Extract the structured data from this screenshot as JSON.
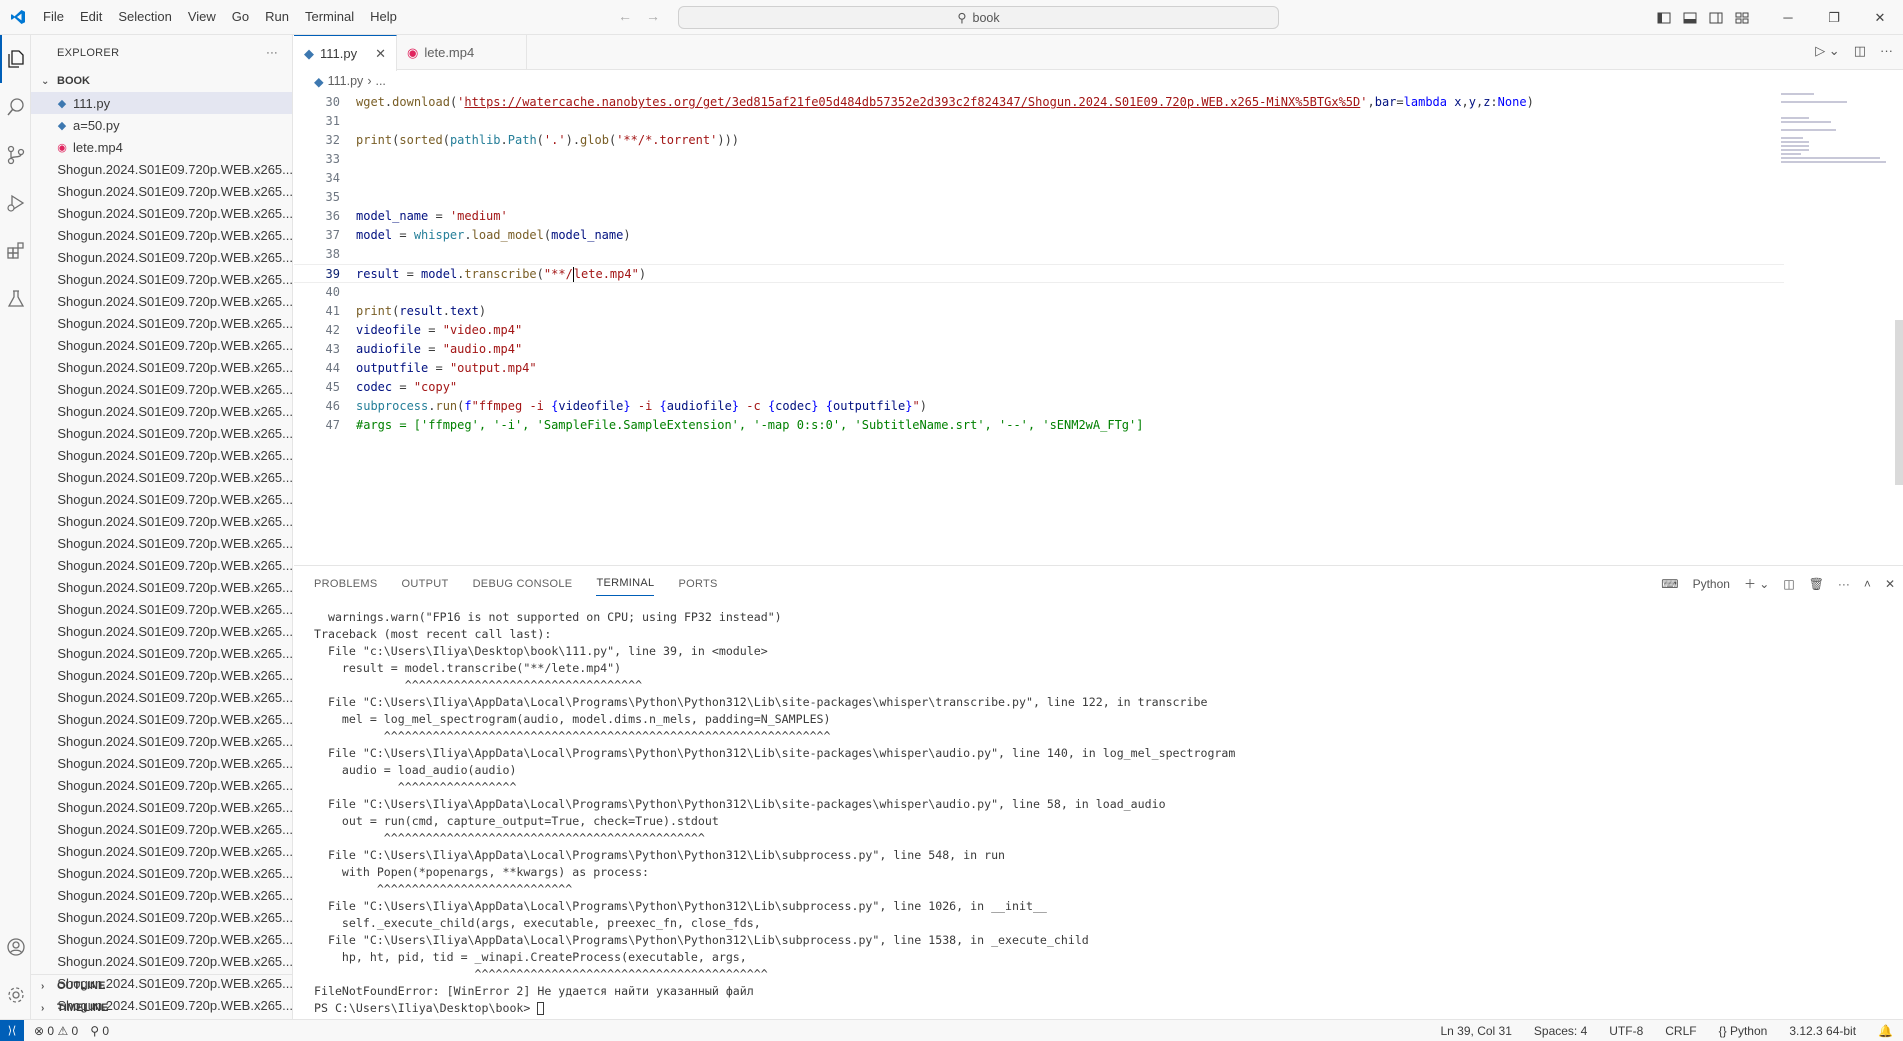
{
  "menu": [
    "File",
    "Edit",
    "Selection",
    "View",
    "Go",
    "Run",
    "Terminal",
    "Help"
  ],
  "search": {
    "text": "book"
  },
  "sidebar": {
    "title": "EXPLORER",
    "folder": "BOOK",
    "files": [
      {
        "name": "111.py",
        "type": "py",
        "active": true
      },
      {
        "name": "a=50.py",
        "type": "py"
      },
      {
        "name": "lete.mp4",
        "type": "mp4"
      }
    ],
    "repeat_file": "Shogun.2024.S01E09.720p.WEB.x265...",
    "repeat_count": 40,
    "outline": "OUTLINE",
    "timeline": "TIMELINE"
  },
  "tabs": [
    {
      "label": "111.py",
      "active": true
    },
    {
      "label": "lete.mp4",
      "active": false
    }
  ],
  "breadcrumb": {
    "file": "111.py",
    "more": "..."
  },
  "code": [
    {
      "n": "30",
      "html": "<span class=\"tk-fn\">wget</span>.<span class=\"tk-fn\">download</span>(<span class=\"tk-str\">'</span><span class=\"tk-url\">https://watercache.nanobytes.org/get/3ed815af21fe05d484db57352e2d393c2f824347/Shogun.2024.S01E09.720p.WEB.x265-MiNX%5BTGx%5D</span><span class=\"tk-str\">'</span>,<span class=\"tk-var\">bar</span>=<span class=\"tk-kw\">lambda</span> <span class=\"tk-var\">x</span>,<span class=\"tk-var\">y</span>,<span class=\"tk-var\">z</span>:<span class=\"tk-kw\">None</span>)"
    },
    {
      "n": "31",
      "html": ""
    },
    {
      "n": "32",
      "html": "<span class=\"tk-fn\">print</span>(<span class=\"tk-fn\">sorted</span>(<span class=\"tk-cls\">pathlib</span>.<span class=\"tk-cls\">Path</span>(<span class=\"tk-str\">'.'</span>).<span class=\"tk-fn\">glob</span>(<span class=\"tk-str\">'**/*.torrent'</span>)))"
    },
    {
      "n": "33",
      "html": ""
    },
    {
      "n": "34",
      "html": ""
    },
    {
      "n": "35",
      "html": ""
    },
    {
      "n": "36",
      "html": "<span class=\"tk-var\">model_name</span> = <span class=\"tk-str\">'medium'</span>"
    },
    {
      "n": "37",
      "html": "<span class=\"tk-var\">model</span> = <span class=\"tk-cls\">whisper</span>.<span class=\"tk-fn\">load_model</span>(<span class=\"tk-var\">model_name</span>)"
    },
    {
      "n": "38",
      "html": ""
    },
    {
      "n": "39",
      "html": "<span class=\"tk-var\">result</span> = <span class=\"tk-var\">model</span>.<span class=\"tk-fn\">transcribe</span>(<span class=\"tk-str\">\"**/</span><span class=\"cursor\"></span><span class=\"tk-str\">lete.mp4\"</span>)",
      "current": true
    },
    {
      "n": "40",
      "html": ""
    },
    {
      "n": "41",
      "html": "<span class=\"tk-fn\">print</span>(<span class=\"tk-var\">result</span>.<span class=\"tk-var\">text</span>)"
    },
    {
      "n": "42",
      "html": "<span class=\"tk-var\">videofile</span> = <span class=\"tk-str\">\"video.mp4\"</span>"
    },
    {
      "n": "43",
      "html": "<span class=\"tk-var\">audiofile</span> = <span class=\"tk-str\">\"audio.mp4\"</span>"
    },
    {
      "n": "44",
      "html": "<span class=\"tk-var\">outputfile</span> = <span class=\"tk-str\">\"output.mp4\"</span>"
    },
    {
      "n": "45",
      "html": "<span class=\"tk-var\">codec</span> = <span class=\"tk-str\">\"copy\"</span>"
    },
    {
      "n": "46",
      "html": "<span class=\"tk-cls\">subprocess</span>.<span class=\"tk-fn\">run</span>(<span class=\"tk-kw\">f</span><span class=\"tk-str\">\"ffmpeg -i </span><span class=\"tk-kw\">{</span><span class=\"tk-var\">videofile</span><span class=\"tk-kw\">}</span><span class=\"tk-str\"> -i </span><span class=\"tk-kw\">{</span><span class=\"tk-var\">audiofile</span><span class=\"tk-kw\">}</span><span class=\"tk-str\"> -c </span><span class=\"tk-kw\">{</span><span class=\"tk-var\">codec</span><span class=\"tk-kw\">}</span><span class=\"tk-str\"> </span><span class=\"tk-kw\">{</span><span class=\"tk-var\">outputfile</span><span class=\"tk-kw\">}</span><span class=\"tk-str\">\"</span>)"
    },
    {
      "n": "47",
      "html": "<span class=\"tk-cm\">#args = ['ffmpeg', '-i', 'SampleFile.SampleExtension', '-map 0:s:0', 'SubtitleName.srt', '--', 'sENM2wA_FTg']</span>"
    }
  ],
  "panel": {
    "tabs": [
      "PROBLEMS",
      "OUTPUT",
      "DEBUG CONSOLE",
      "TERMINAL",
      "PORTS"
    ],
    "active_tab": "TERMINAL",
    "shell": "Python"
  },
  "terminal": [
    "  warnings.warn(\"FP16 is not supported on CPU; using FP32 instead\")",
    "Traceback (most recent call last):",
    "  File \"c:\\Users\\Iliya\\Desktop\\book\\111.py\", line 39, in <module>",
    "    result = model.transcribe(\"**/lete.mp4\")",
    "             ^^^^^^^^^^^^^^^^^^^^^^^^^^^^^^^^^^",
    "  File \"C:\\Users\\Iliya\\AppData\\Local\\Programs\\Python\\Python312\\Lib\\site-packages\\whisper\\transcribe.py\", line 122, in transcribe",
    "    mel = log_mel_spectrogram(audio, model.dims.n_mels, padding=N_SAMPLES)",
    "          ^^^^^^^^^^^^^^^^^^^^^^^^^^^^^^^^^^^^^^^^^^^^^^^^^^^^^^^^^^^^^^^^",
    "  File \"C:\\Users\\Iliya\\AppData\\Local\\Programs\\Python\\Python312\\Lib\\site-packages\\whisper\\audio.py\", line 140, in log_mel_spectrogram",
    "    audio = load_audio(audio)",
    "            ^^^^^^^^^^^^^^^^^",
    "  File \"C:\\Users\\Iliya\\AppData\\Local\\Programs\\Python\\Python312\\Lib\\site-packages\\whisper\\audio.py\", line 58, in load_audio",
    "    out = run(cmd, capture_output=True, check=True).stdout",
    "          ^^^^^^^^^^^^^^^^^^^^^^^^^^^^^^^^^^^^^^^^^^^^^^",
    "  File \"C:\\Users\\Iliya\\AppData\\Local\\Programs\\Python\\Python312\\Lib\\subprocess.py\", line 548, in run",
    "    with Popen(*popenargs, **kwargs) as process:",
    "         ^^^^^^^^^^^^^^^^^^^^^^^^^^^^",
    "  File \"C:\\Users\\Iliya\\AppData\\Local\\Programs\\Python\\Python312\\Lib\\subprocess.py\", line 1026, in __init__",
    "    self._execute_child(args, executable, preexec_fn, close_fds,",
    "  File \"C:\\Users\\Iliya\\AppData\\Local\\Programs\\Python\\Python312\\Lib\\subprocess.py\", line 1538, in _execute_child",
    "    hp, ht, pid, tid = _winapi.CreateProcess(executable, args,",
    "                       ^^^^^^^^^^^^^^^^^^^^^^^^^^^^^^^^^^^^^^^^^^",
    "FileNotFoundError: [WinError 2] Не удается найти указанный файл",
    "PS C:\\Users\\Iliya\\Desktop\\book> "
  ],
  "status": {
    "errors": "0",
    "warnings": "0",
    "ports": "0",
    "position": "Ln 39, Col 31",
    "spaces": "Spaces: 4",
    "encoding": "UTF-8",
    "eol": "CRLF",
    "language": "Python",
    "interpreter": "3.12.3 64-bit"
  },
  "colors": {
    "accent": "#005fb8",
    "py_icon": "#3d78b0",
    "mp4_icon": "#e0245e"
  }
}
